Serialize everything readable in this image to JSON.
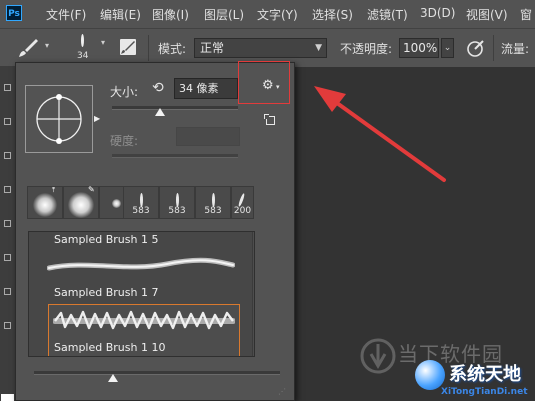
{
  "app": {
    "logo": "Ps"
  },
  "menu": [
    "文件(F)",
    "编辑(E)",
    "图像(I)",
    "图层(L)",
    "文字(Y)",
    "选择(S)",
    "滤镜(T)",
    "3D(D)",
    "视图(V)",
    "窗"
  ],
  "options_bar": {
    "brush_size": "34",
    "mode_label": "模式:",
    "mode_value": "正常",
    "opacity_label": "不透明度:",
    "opacity_value": "100%",
    "flow_label": "流量:"
  },
  "brush_panel": {
    "size_label": "大小:",
    "size_value": "34 像素",
    "hardness_label": "硬度:",
    "presets": [
      "583",
      "583",
      "583",
      "200"
    ],
    "brushes": [
      {
        "name": "Sampled Brush 1 5"
      },
      {
        "name": "Sampled Brush 1 7"
      },
      {
        "name": "Sampled Brush 1 10"
      }
    ]
  },
  "watermark": {
    "text1": "当下软件园",
    "text2": "系统天地",
    "url": "XiTongTianDi.net"
  },
  "colors": {
    "highlight": "#e23b3b",
    "selected_border": "#d9792e"
  }
}
